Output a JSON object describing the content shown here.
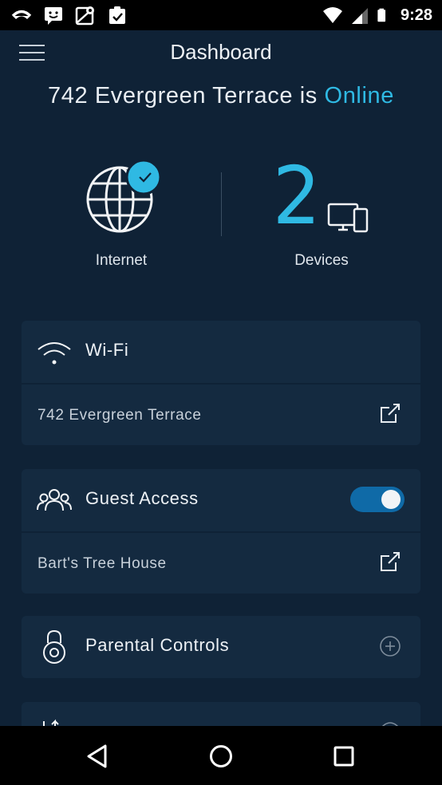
{
  "status_bar": {
    "time": "9:28",
    "notification_icons": [
      "cast-icon",
      "message-icon",
      "maps-icon",
      "clipboard-icon"
    ],
    "system_icons": [
      "wifi-icon",
      "signal-icon",
      "battery-icon"
    ]
  },
  "app_bar": {
    "title": "Dashboard",
    "menu_icon": "hamburger-menu-icon"
  },
  "network_status": {
    "prefix": "742 Evergreen Terrace is",
    "state": "Online",
    "state_color": "#2fb9e3"
  },
  "summary": {
    "internet_label": "Internet",
    "device_count": "2",
    "devices_label": "Devices"
  },
  "wifi_card": {
    "title": "Wi-Fi",
    "network_name": "742 Evergreen Terrace"
  },
  "guest_card": {
    "title": "Guest Access",
    "network_name": "Bart's Tree House",
    "toggle_on": true
  },
  "parental_card": {
    "title": "Parental Controls"
  },
  "nav_bar": {
    "buttons": [
      "back-icon",
      "home-icon",
      "recents-icon"
    ]
  },
  "colors": {
    "background": "#0f2236",
    "card": "#142a40",
    "accent": "#2fb9e3",
    "toggle": "#0f6aa7"
  }
}
